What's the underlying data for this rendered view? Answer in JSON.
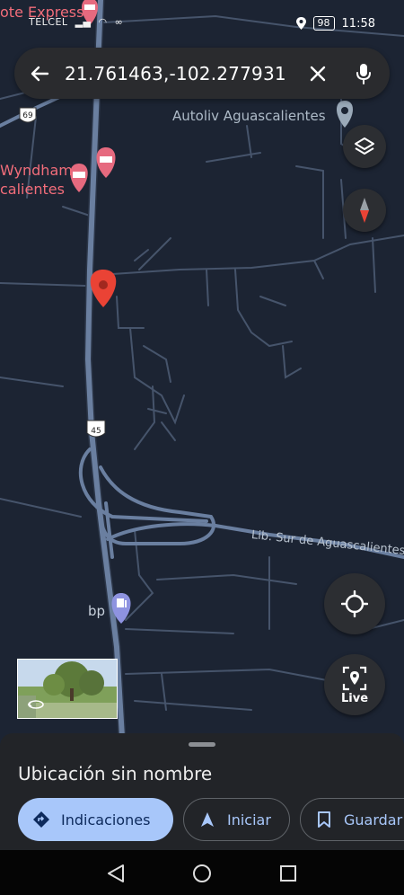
{
  "status_bar": {
    "carrier": "TELCEL",
    "battery": "98",
    "time": "11:58"
  },
  "search": {
    "query": "21.761463,-102.277931"
  },
  "map": {
    "labels": {
      "hotel_top": "ote Express",
      "hotel_wyndham_line1": "Wyndham",
      "hotel_wyndham_line2": "calientes",
      "poi_autoliv": "Autoliv Aguascalientes",
      "road_lib_sur": "Lib. Sur de Aguascalientes",
      "gas_station": "bp",
      "highway_69": "69",
      "highway_45": "45"
    },
    "live_label": "Live"
  },
  "bottom_sheet": {
    "title": "Ubicación sin nombre",
    "directions_label": "Indicaciones",
    "start_label": "Iniciar",
    "save_label": "Guardar"
  },
  "icons": {
    "back": "arrow-left-icon",
    "clear": "close-icon",
    "mic": "microphone-icon",
    "layers": "layers-icon",
    "compass": "compass-icon",
    "my_location": "crosshair-icon",
    "live_view": "live-view-icon",
    "directions": "directions-diamond-icon",
    "start": "navigation-arrow-icon",
    "save": "bookmark-icon",
    "nav_back": "triangle-back-icon",
    "nav_home": "circle-home-icon",
    "nav_recent": "square-recents-icon"
  },
  "colors": {
    "map_background": "#1c2433",
    "road": "#5b6f8d",
    "minor_road": "#4c5a70",
    "pin": "#ea4335",
    "hotel_pin": "#e66a7f",
    "primary_chip": "#a8c7fa",
    "sheet": "#222428"
  }
}
